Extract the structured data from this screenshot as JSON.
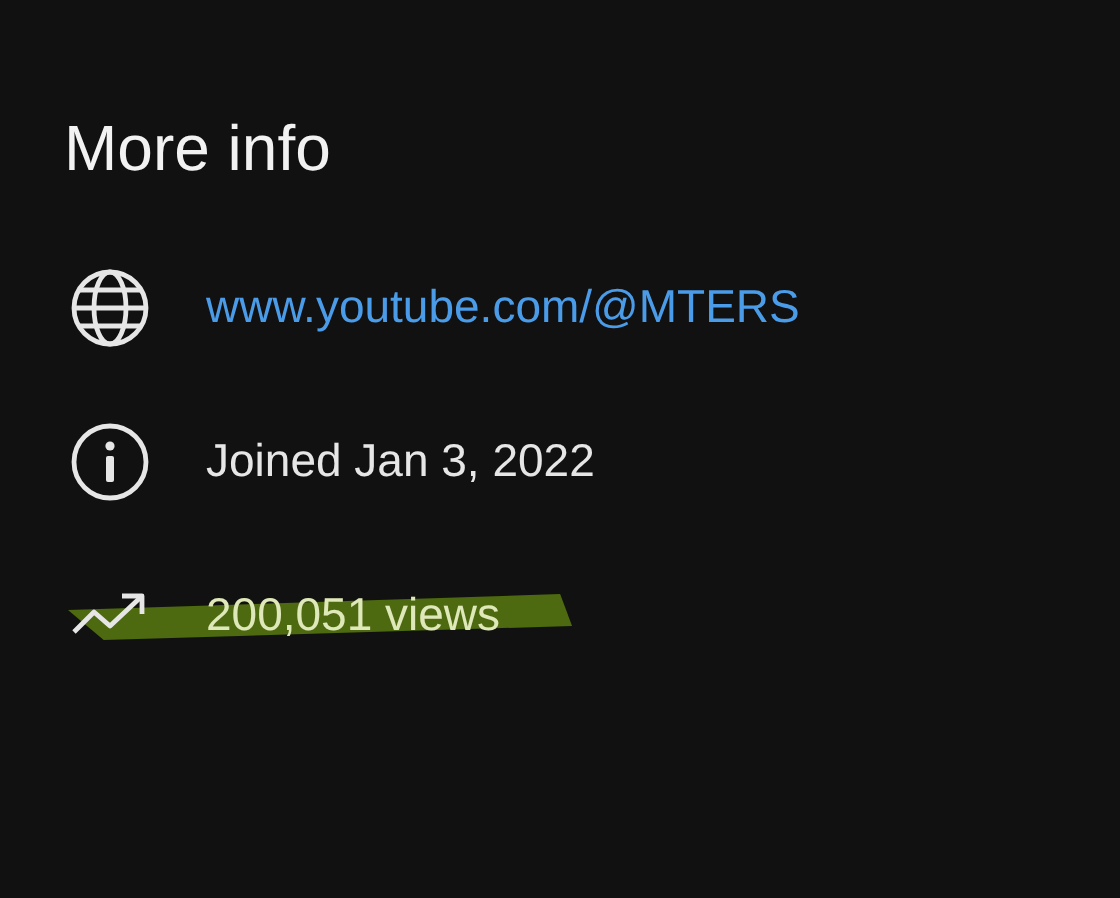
{
  "title": "More info",
  "rows": [
    {
      "kind": "link",
      "text": "www.youtube.com/@MTERS",
      "highlighted": false
    },
    {
      "kind": "joined",
      "text": "Joined Jan 3, 2022",
      "highlighted": false
    },
    {
      "kind": "views",
      "text": "200,051 views",
      "highlighted": true
    }
  ]
}
